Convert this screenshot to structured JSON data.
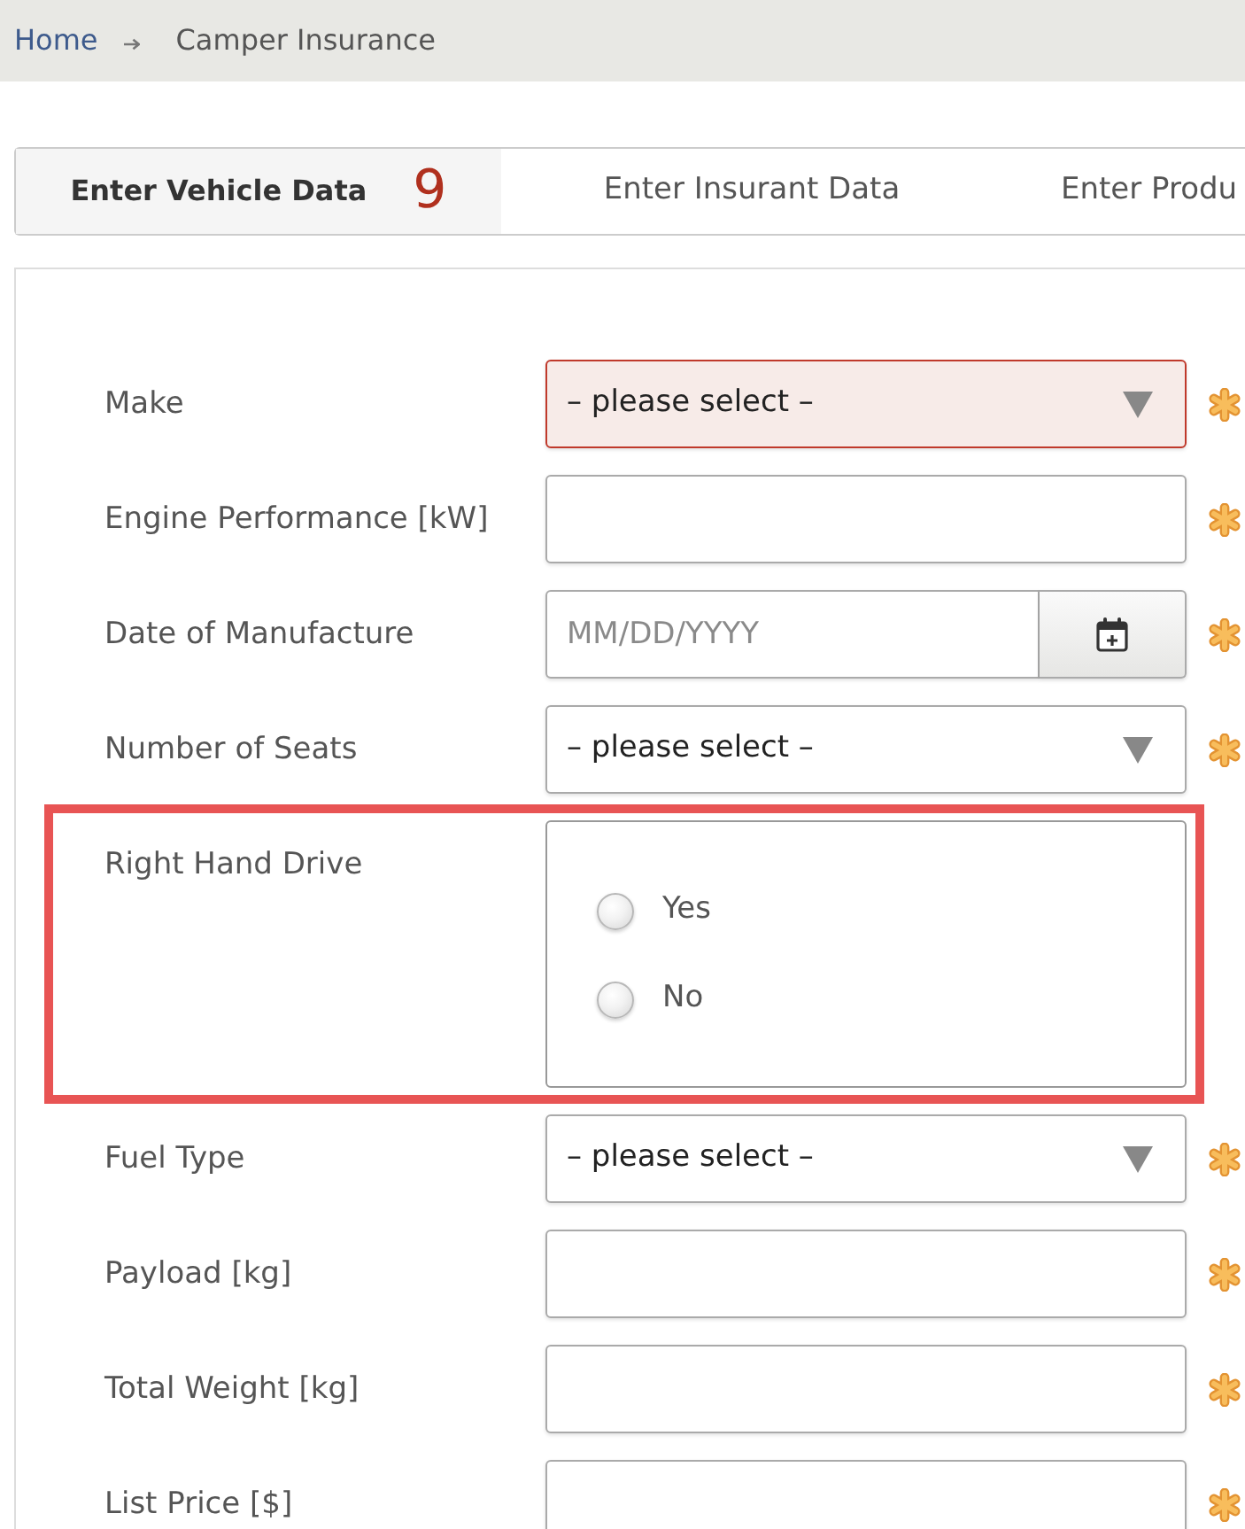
{
  "breadcrumb": [
    {
      "label": "Home",
      "kind": "link"
    },
    {
      "label": "Camper Insurance",
      "kind": "current"
    }
  ],
  "tabs": [
    {
      "label": "Enter Vehicle Data",
      "count": "9",
      "selected": true
    },
    {
      "label": "Enter Insurant Data",
      "selected": false
    },
    {
      "label": "Enter Produ",
      "selected": false
    }
  ],
  "form": {
    "fields": [
      {
        "label": "Make",
        "kind": "select",
        "value": "– please select –",
        "invalid": true,
        "required": true,
        "highlighted": false
      },
      {
        "label": "Engine Performance [kW]",
        "kind": "text",
        "invalid": false,
        "required": true,
        "highlighted": false
      },
      {
        "label": "Date of Manufacture",
        "kind": "date",
        "placeholder": "MM/DD/YYYY",
        "invalid": false,
        "required": true,
        "highlighted": false
      },
      {
        "label": "Number of Seats",
        "kind": "select",
        "value": "– please select –",
        "invalid": false,
        "required": true,
        "highlighted": false
      },
      {
        "label": "Right Hand Drive",
        "kind": "radio",
        "options": [
          {
            "label": "Yes",
            "selected": false
          },
          {
            "label": "No",
            "selected": false
          }
        ],
        "invalid": false,
        "required": false,
        "highlighted": true
      },
      {
        "label": "Fuel Type",
        "kind": "select",
        "value": "– please select –",
        "invalid": false,
        "required": true,
        "highlighted": false
      },
      {
        "label": "Payload [kg]",
        "kind": "text",
        "invalid": false,
        "required": true,
        "highlighted": false
      },
      {
        "label": "Total Weight [kg]",
        "kind": "text",
        "invalid": false,
        "required": true,
        "highlighted": false
      },
      {
        "label": "List Price [$]",
        "kind": "text",
        "invalid": false,
        "required": true,
        "highlighted": false
      }
    ]
  }
}
